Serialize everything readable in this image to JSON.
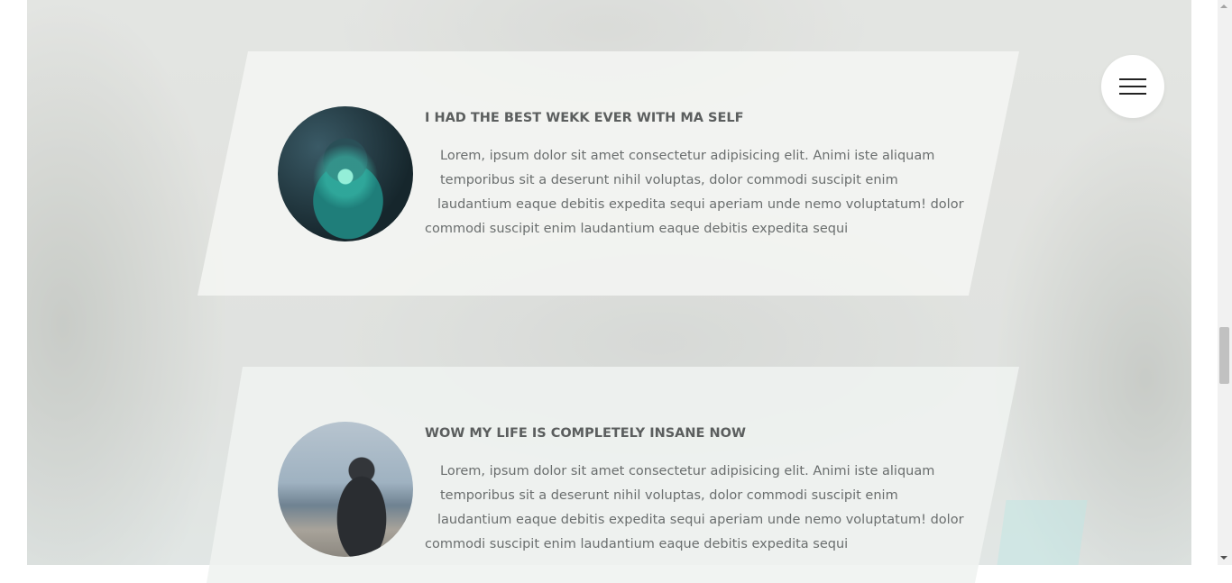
{
  "posts": [
    {
      "title": "I HAD THE BEST WEKK EVER WITH MA SELF",
      "body_lines": [
        "Lorem, ipsum dolor sit amet consectetur adipisicing elit. Animi iste aliquam",
        "temporibus sit a deserunt nihil voluptas, dolor commodi suscipit enim",
        "laudantium eaque debitis expedita sequi aperiam unde nemo voluptatum! dolor",
        "commodi suscipit enim laudantium eaque debitis expedita sequi"
      ]
    },
    {
      "title": "WOW MY LIFE IS COMPLETELY INSANE NOW",
      "body_lines": [
        "Lorem, ipsum dolor sit amet consectetur adipisicing elit. Animi iste aliquam",
        "temporibus sit a deserunt nihil voluptas, dolor commodi suscipit enim",
        "laudantium eaque debitis expedita sequi aperiam unde nemo voluptatum! dolor",
        "commodi suscipit enim laudantium eaque debitis expedita sequi"
      ]
    }
  ],
  "menu": {
    "icon": "hamburger-menu-icon"
  },
  "scrollbar": {
    "position_fraction": 0.58
  }
}
